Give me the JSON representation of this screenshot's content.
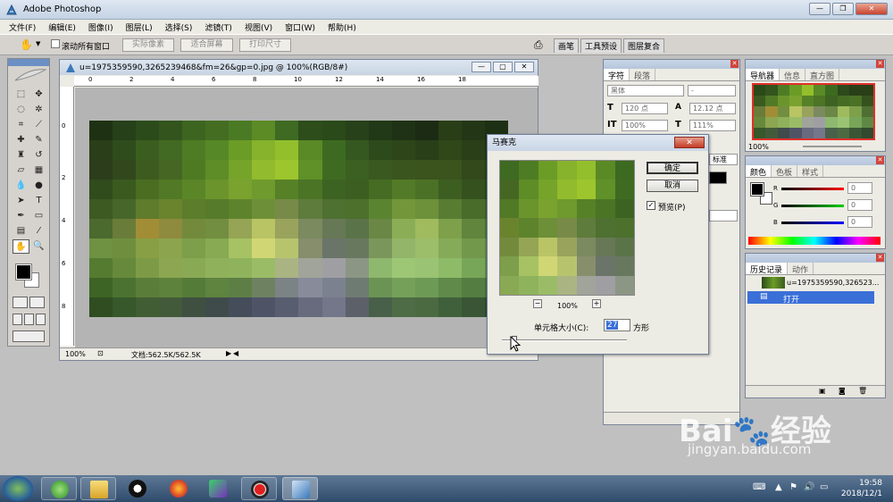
{
  "app": {
    "title": "Adobe Photoshop"
  },
  "menu": [
    "文件(F)",
    "编辑(E)",
    "图像(I)",
    "图层(L)",
    "选择(S)",
    "滤镜(T)",
    "视图(V)",
    "窗口(W)",
    "帮助(H)"
  ],
  "options": {
    "scroll_all": "滚动所有窗口",
    "actual_pixels": "实际像素",
    "fit_screen": "适合屏幕",
    "print_size": "打印尺寸",
    "well_tabs": [
      "画笔",
      "工具预设",
      "图层复合"
    ]
  },
  "document": {
    "title": "u=1975359590,3265239468&fm=26&gp=0.jpg @ 100%(RGB/8#)",
    "zoom": "100%",
    "doc_size": "文档:562.5K/562.5K",
    "ruler_h": [
      "0",
      "2",
      "4",
      "6",
      "8",
      "10",
      "12",
      "14",
      "16",
      "18"
    ],
    "ruler_v": [
      "0",
      "2",
      "4",
      "6",
      "8"
    ]
  },
  "char_panel": {
    "tabs": [
      "字符",
      "段落"
    ],
    "font": "黑体",
    "style": "-",
    "size": "120 点",
    "leading": "12.12 点",
    "vscale": "100%",
    "hscale": "111%",
    "aa": "标准"
  },
  "navigator": {
    "tabs": [
      "导航器",
      "信息",
      "直方图"
    ],
    "zoom": "100%"
  },
  "color_panel": {
    "tabs": [
      "颜色",
      "色板",
      "样式"
    ],
    "r": "0",
    "g": "0",
    "b": "0"
  },
  "history": {
    "tabs": [
      "历史记录",
      "动作"
    ],
    "snapshot": "u=1975359590,326523...",
    "step": "打开"
  },
  "dialog": {
    "title": "马赛克",
    "ok": "确定",
    "cancel": "取消",
    "preview_label": "预览(P)",
    "preview_checked": true,
    "zoom": "100%",
    "cell_label": "单元格大小(C):",
    "cell_value": "27",
    "unit": "方形",
    "cell_fraction": 0.1
  },
  "taskbar": {
    "time": "19:58",
    "date": "2018/12/1"
  },
  "watermark": {
    "brand": "Bai",
    "brand2": "经验",
    "url": "jingyan.baidu.com"
  },
  "mosaic_colors": [
    [
      "#1e3113",
      "#26401a",
      "#2b4c1a",
      "#33541d",
      "#3d6520",
      "#446d22",
      "#4a7a24",
      "#5c8a25",
      "#3e6a22",
      "#2d4d1b",
      "#2a4a19",
      "#27411a",
      "#213916",
      "#1f3215",
      "#1c2b13",
      "#293e17",
      "#233716",
      "#1e3014"
    ],
    [
      "#2a3e19",
      "#2f4c1d",
      "#3b5e20",
      "#426a22",
      "#4d7c24",
      "#578827",
      "#6b9c26",
      "#86b22c",
      "#93bf2c",
      "#5a8a25",
      "#3d6a21",
      "#34581f",
      "#2c4a1b",
      "#2d4519",
      "#293f18",
      "#2f4719",
      "#2a3e17",
      "#22341a"
    ],
    [
      "#2b3d1a",
      "#32481c",
      "#3d5b1f",
      "#456723",
      "#4f7a24",
      "#5e8c26",
      "#76a32a",
      "#92bb2d",
      "#9dc52e",
      "#5f9128",
      "#3f6a22",
      "#3c6021",
      "#3a5920",
      "#3a551e",
      "#3b531d",
      "#3b531d",
      "#33491b",
      "#29401a"
    ],
    [
      "#304b1c",
      "#3a5a1f",
      "#4a6d22",
      "#517926",
      "#5b8628",
      "#6b952c",
      "#7aa22f",
      "#6e9a2e",
      "#568127",
      "#4b7425",
      "#3d6322",
      "#3c5e21",
      "#466c24",
      "#537a27",
      "#4b7126",
      "#3d5e21",
      "#35521e",
      "#2d461b"
    ],
    [
      "#3c5a22",
      "#47672a",
      "#5f7c2c",
      "#6a842d",
      "#5c7d2b",
      "#567b2a",
      "#5d842c",
      "#6d8f38",
      "#788a48",
      "#5e7c3c",
      "#4e7030",
      "#4d702d",
      "#5b8431",
      "#73963b",
      "#6d903a",
      "#587c32",
      "#4a6c2b",
      "#3f5d25"
    ],
    [
      "#4a6a2e",
      "#6a7c3a",
      "#a18d36",
      "#8e8a3e",
      "#738a3d",
      "#728e40",
      "#95a455",
      "#b9c465",
      "#9aa35c",
      "#7b8a5f",
      "#667856",
      "#5b7348",
      "#6a8745",
      "#8bad55",
      "#a0bb5e",
      "#7ea04a",
      "#61853d",
      "#4f7034"
    ],
    [
      "#6e9142",
      "#6f8f3e",
      "#889f45",
      "#8ca44d",
      "#7d9e4a",
      "#87aa52",
      "#a6c262",
      "#d1d674",
      "#b7c46d",
      "#868e6c",
      "#6a7468",
      "#68785f",
      "#7b965b",
      "#93b56a",
      "#9cbd6a",
      "#86ab58",
      "#72984b",
      "#5f8541"
    ],
    [
      "#557b31",
      "#66893b",
      "#7d9b47",
      "#8ca651",
      "#8aa955",
      "#90b15b",
      "#8fb35c",
      "#9bbc66",
      "#aab482",
      "#a0a49a",
      "#9f9fa3",
      "#8b9684",
      "#8db86e",
      "#9dc775",
      "#9ac473",
      "#8ebb68",
      "#78a658",
      "#5f8845"
    ],
    [
      "#3d6425",
      "#4b7230",
      "#5a7d3a",
      "#5d823b",
      "#557b38",
      "#5e843f",
      "#5d7f45",
      "#6e8161",
      "#7b8385",
      "#878b9a",
      "#7c8190",
      "#6e7b72",
      "#6a9354",
      "#74a05a",
      "#6d9a55",
      "#5f8a49",
      "#547d42",
      "#456f38"
    ],
    [
      "#2f4d21",
      "#36582a",
      "#415d33",
      "#435a3a",
      "#3f5040",
      "#3f4b4a",
      "#454c5a",
      "#4e5466",
      "#585d70",
      "#676b7d",
      "#74768a",
      "#5c6069",
      "#486049",
      "#4e6c45",
      "#4b6a42",
      "#40603c",
      "#395535",
      "#31492d"
    ]
  ],
  "dialog_mosaic": [
    [
      "#3e6a22",
      "#4d7c24",
      "#6b9c26",
      "#86b22c",
      "#93bf2c",
      "#5a8a25",
      "#3d6a21"
    ],
    [
      "#456723",
      "#5e8c26",
      "#76a32a",
      "#92bb2d",
      "#9dc52e",
      "#5f9128",
      "#3f6a22"
    ],
    [
      "#517926",
      "#6b952c",
      "#7aa22f",
      "#6e9a2e",
      "#568127",
      "#4b7425",
      "#3d6322"
    ],
    [
      "#6a842d",
      "#5d842c",
      "#6d8f38",
      "#788a48",
      "#5e7c3c",
      "#4e7030",
      "#4d702d"
    ],
    [
      "#738a3d",
      "#95a455",
      "#b9c465",
      "#9aa35c",
      "#7b8a5f",
      "#667856",
      "#5b7348"
    ],
    [
      "#7d9e4a",
      "#a6c262",
      "#d1d674",
      "#b7c46d",
      "#868e6c",
      "#6a7468",
      "#68785f"
    ],
    [
      "#8aa955",
      "#8fb35c",
      "#9bbc66",
      "#aab482",
      "#a0a49a",
      "#9f9fa3",
      "#8b9684"
    ]
  ],
  "nav_mosaic": [
    [
      "#2a4a19",
      "#33541d",
      "#4d7c24",
      "#6b9c26",
      "#93bf2c",
      "#5a8a25",
      "#3d6a21",
      "#2c4a1b",
      "#293f18",
      "#2a3e17"
    ],
    [
      "#3a5a1f",
      "#517926",
      "#6b952c",
      "#7aa22f",
      "#568127",
      "#4b7425",
      "#3d6322",
      "#466c24",
      "#4b7126",
      "#35521e"
    ],
    [
      "#6a7c3a",
      "#a18d36",
      "#728e40",
      "#b9c465",
      "#9aa35c",
      "#7b8a5f",
      "#6a8745",
      "#a0bb5e",
      "#7ea04a",
      "#4f7034"
    ],
    [
      "#66893b",
      "#8ca651",
      "#90b15b",
      "#9bbc66",
      "#a0a49a",
      "#9f9fa3",
      "#8db86e",
      "#9ac473",
      "#78a658",
      "#5f8845"
    ],
    [
      "#36582a",
      "#435a3a",
      "#3f4b4a",
      "#4e5466",
      "#676b7d",
      "#74768a",
      "#486049",
      "#4b6a42",
      "#395535",
      "#31492d"
    ]
  ]
}
